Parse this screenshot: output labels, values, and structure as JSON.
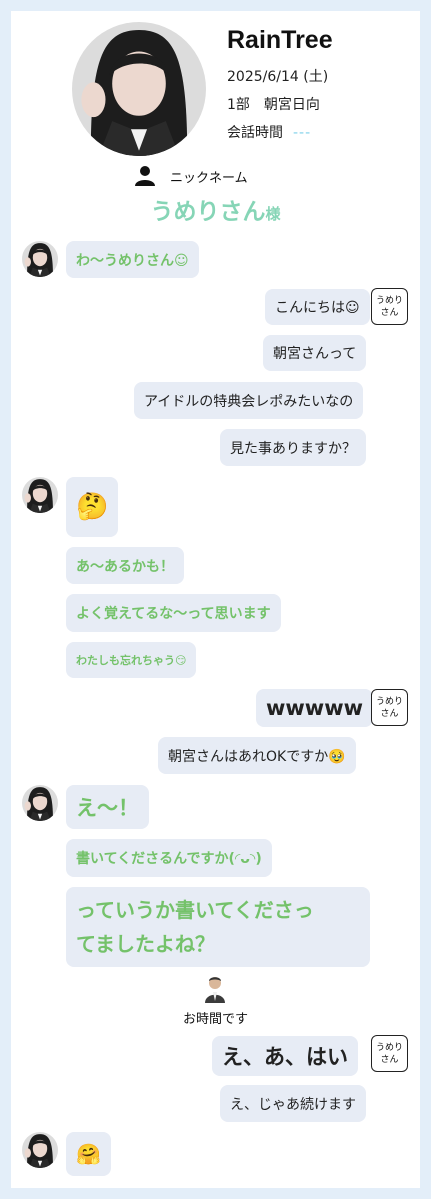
{
  "header": {
    "name": "RainTree",
    "date": "2025/6/14 (土)",
    "session": "1部　朝宮日向",
    "talk_time_label": "会話時間",
    "talk_time_value": "---"
  },
  "nickname": {
    "label": "ニックネーム",
    "value": "うめりさん",
    "suffix": "様"
  },
  "user_tag": "うめり\nさん",
  "messages": {
    "m1": "わ〜うめりさん☺",
    "m2": "こんにちは☺",
    "m3": "朝宮さんって",
    "m4": "アイドルの特典会レポみたいなの",
    "m5": "見た事ありますか？",
    "m6": "🤔",
    "m7": "あ〜あるかも！",
    "m8": "よく覚えてるな〜って思います",
    "m9": "わたしも忘れちゃう😏",
    "m10": "wwwww",
    "m11": "朝宮さんはあれOKですか🥹",
    "m12": "え〜！",
    "m13": "書いてくださるんですか(◜ᴗ◝)",
    "m14a": "っていうか書いてくださっ",
    "m14b": "てましたよね？",
    "m15": "え、あ、はい",
    "m16": "え、じゃあ続けます",
    "m17": "🤗"
  },
  "staff_notice": "お時間です",
  "colors": {
    "background": "#e3eef9",
    "bubble": "#e7ecf5",
    "idol_text": "#74c26a",
    "nickname": "#86d5b6",
    "timer": "#7fd0ea"
  }
}
